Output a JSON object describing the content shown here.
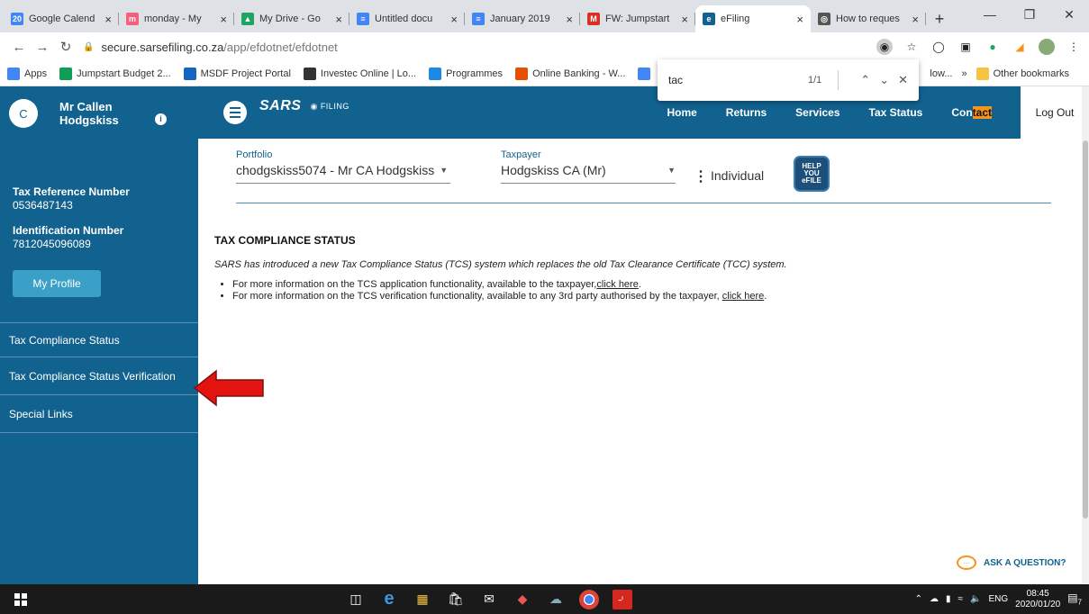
{
  "browser": {
    "tabs": [
      {
        "label": "Google Calend",
        "fav": "20",
        "color": "#4285f4"
      },
      {
        "label": "monday - My",
        "fav": "m",
        "color": "#f65f7c"
      },
      {
        "label": "My Drive - Go",
        "fav": "▲",
        "color": "#1fa463"
      },
      {
        "label": "Untitled docu",
        "fav": "≡",
        "color": "#4285f4"
      },
      {
        "label": "January 2019",
        "fav": "≡",
        "color": "#4285f4"
      },
      {
        "label": "FW: Jumpstart",
        "fav": "M",
        "color": "#d93025"
      },
      {
        "label": "eFiling",
        "fav": "e",
        "color": "#12628f"
      },
      {
        "label": "How to reques",
        "fav": "◎",
        "color": "#555"
      }
    ],
    "url_host": "secure.sarsefiling.co.za",
    "url_path": "/app/efdotnet/efdotnet",
    "bookmarks": [
      {
        "label": "Apps",
        "color": "#4285f4"
      },
      {
        "label": "Jumpstart Budget 2...",
        "color": "#0f9d58"
      },
      {
        "label": "MSDF Project Portal",
        "color": "#1565c0"
      },
      {
        "label": "Investec Online | Lo...",
        "color": "#333"
      },
      {
        "label": "Programmes",
        "color": "#1e88e5"
      },
      {
        "label": "Online Banking - W...",
        "color": "#e65100"
      },
      {
        "label": "",
        "color": "#4285f4"
      }
    ],
    "bookmark_overflow": "low...",
    "other_bookmarks": "Other bookmarks",
    "find": {
      "query": "tac",
      "count": "1/1"
    }
  },
  "sidebar": {
    "avatar_letter": "C",
    "name_line1": "Mr Callen",
    "name_line2": "Hodgskiss",
    "tax_ref_label": "Tax Reference Number",
    "tax_ref_value": "0536487143",
    "id_label": "Identification Number",
    "id_value": "7812045096089",
    "my_profile": "My Profile",
    "nav": [
      "Tax Compliance Status",
      "Tax Compliance Status Verification",
      "Special Links"
    ]
  },
  "header": {
    "logo": "SARS",
    "logo_sub": "FILING",
    "menu": [
      "Home",
      "Returns",
      "Services",
      "Tax Status"
    ],
    "contact_pre": "Con",
    "contact_hl": "tact",
    "logout": "Log Out"
  },
  "selectors": {
    "portfolio_label": "Portfolio",
    "portfolio_value": "chodgskiss5074 - Mr CA Hodgskiss",
    "taxpayer_label": "Taxpayer",
    "taxpayer_value": "Hodgskiss CA (Mr)",
    "type": "Individual",
    "help_badge": "HELP YOU eFILE"
  },
  "content": {
    "title": "TAX COMPLIANCE STATUS",
    "intro": "SARS has introduced a new Tax Compliance Status (TCS) system which replaces the old Tax Clearance Certificate (TCC) system.",
    "bullet1_text": "For more information on the TCS application functionality, available to the taxpayer,",
    "bullet2_text": "For more information on the TCS verification functionality, available to any 3rd party authorised by the taxpayer, ",
    "link": "click here",
    "ask": "ASK A QUESTION?"
  },
  "taskbar": {
    "lang": "ENG",
    "time": "08:45",
    "date": "2020/01/20",
    "notif_count": "7"
  },
  "colors": {
    "brand": "#12628f",
    "accent": "#f4941c",
    "arrow": "#e3140f"
  }
}
